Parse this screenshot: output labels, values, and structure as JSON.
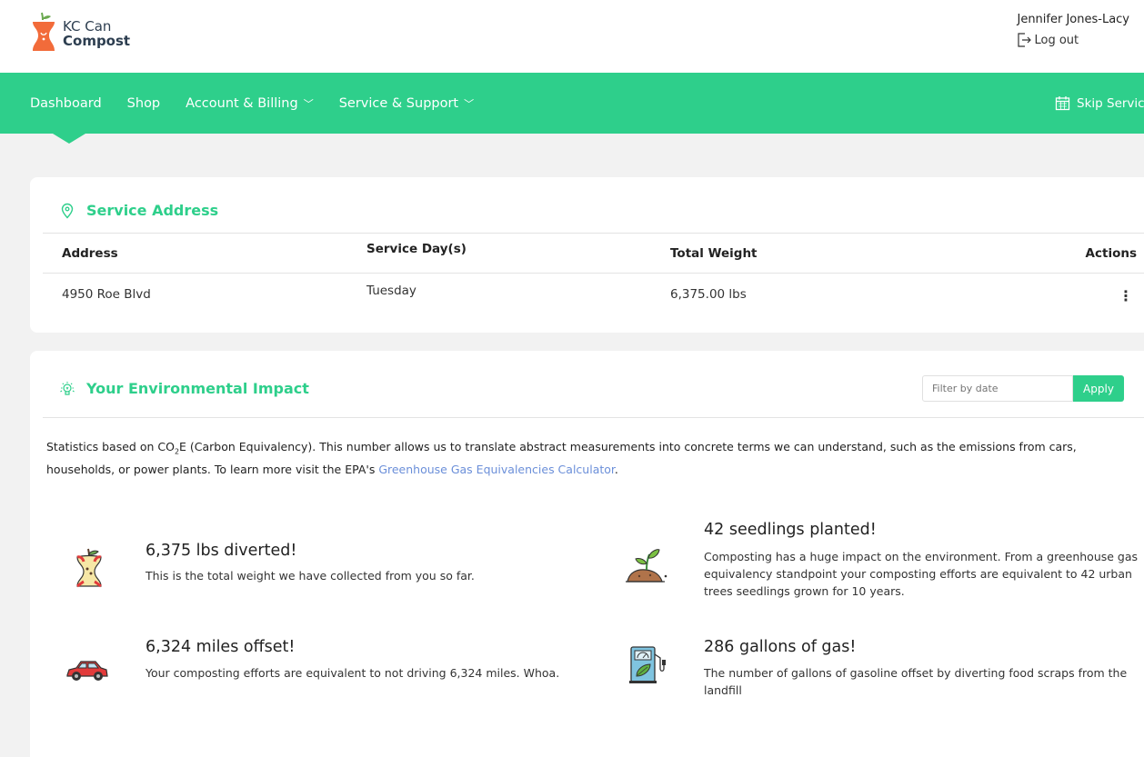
{
  "brand": {
    "line1": "KC Can",
    "line2": "Compost"
  },
  "user": {
    "name": "Jennifer Jones-Lacy",
    "logout_label": "Log out"
  },
  "nav": {
    "items": [
      {
        "label": "Dashboard",
        "dropdown": false
      },
      {
        "label": "Shop",
        "dropdown": false
      },
      {
        "label": "Account & Billing",
        "dropdown": true
      },
      {
        "label": "Service & Support",
        "dropdown": true
      }
    ],
    "skip_label": "Skip Servic"
  },
  "service": {
    "title": "Service Address",
    "columns": [
      "Address",
      "Service Day(s)",
      "Total Weight",
      "Actions"
    ],
    "rows": [
      {
        "address": "4950 Roe Blvd",
        "day": "Tuesday",
        "weight": "6,375.00 lbs",
        "actions": "⋮"
      }
    ]
  },
  "impact": {
    "title": "Your Environmental Impact",
    "filter_placeholder": "Filter by date",
    "apply_label": "Apply",
    "desc_before": "Statistics based on CO",
    "desc_sub": "2",
    "desc_after": "E (Carbon Equivalency). This number allows us to translate abstract measurements into concrete terms we can understand, such as the emissions from cars, households, or power plants. To learn more visit the EPA's ",
    "desc_link": "Greenhouse Gas Equivalencies Calculator",
    "desc_end": ".",
    "stats": [
      {
        "title": "6,375 lbs diverted!",
        "text": "This is the total weight we have collected from you so far.",
        "icon": "apple-core-icon"
      },
      {
        "title": "42 seedlings planted!",
        "text": "Composting has a huge impact on the environment. From a greenhouse gas equivalency standpoint your composting efforts are equivalent to 42 urban trees seedlings grown for 10 years.",
        "icon": "seedling-icon"
      },
      {
        "title": "6,324 miles offset!",
        "text": "Your composting efforts are equivalent to not driving 6,324 miles. Whoa.",
        "icon": "car-icon"
      },
      {
        "title": "286 gallons of gas!",
        "text": "The number of gallons of gasoline offset by diverting food scraps from the landfill",
        "icon": "gas-pump-icon"
      }
    ]
  },
  "colors": {
    "brand_green": "#2ecf8b",
    "logo_orange": "#f26b3a",
    "link_blue": "#6b8fd9"
  }
}
